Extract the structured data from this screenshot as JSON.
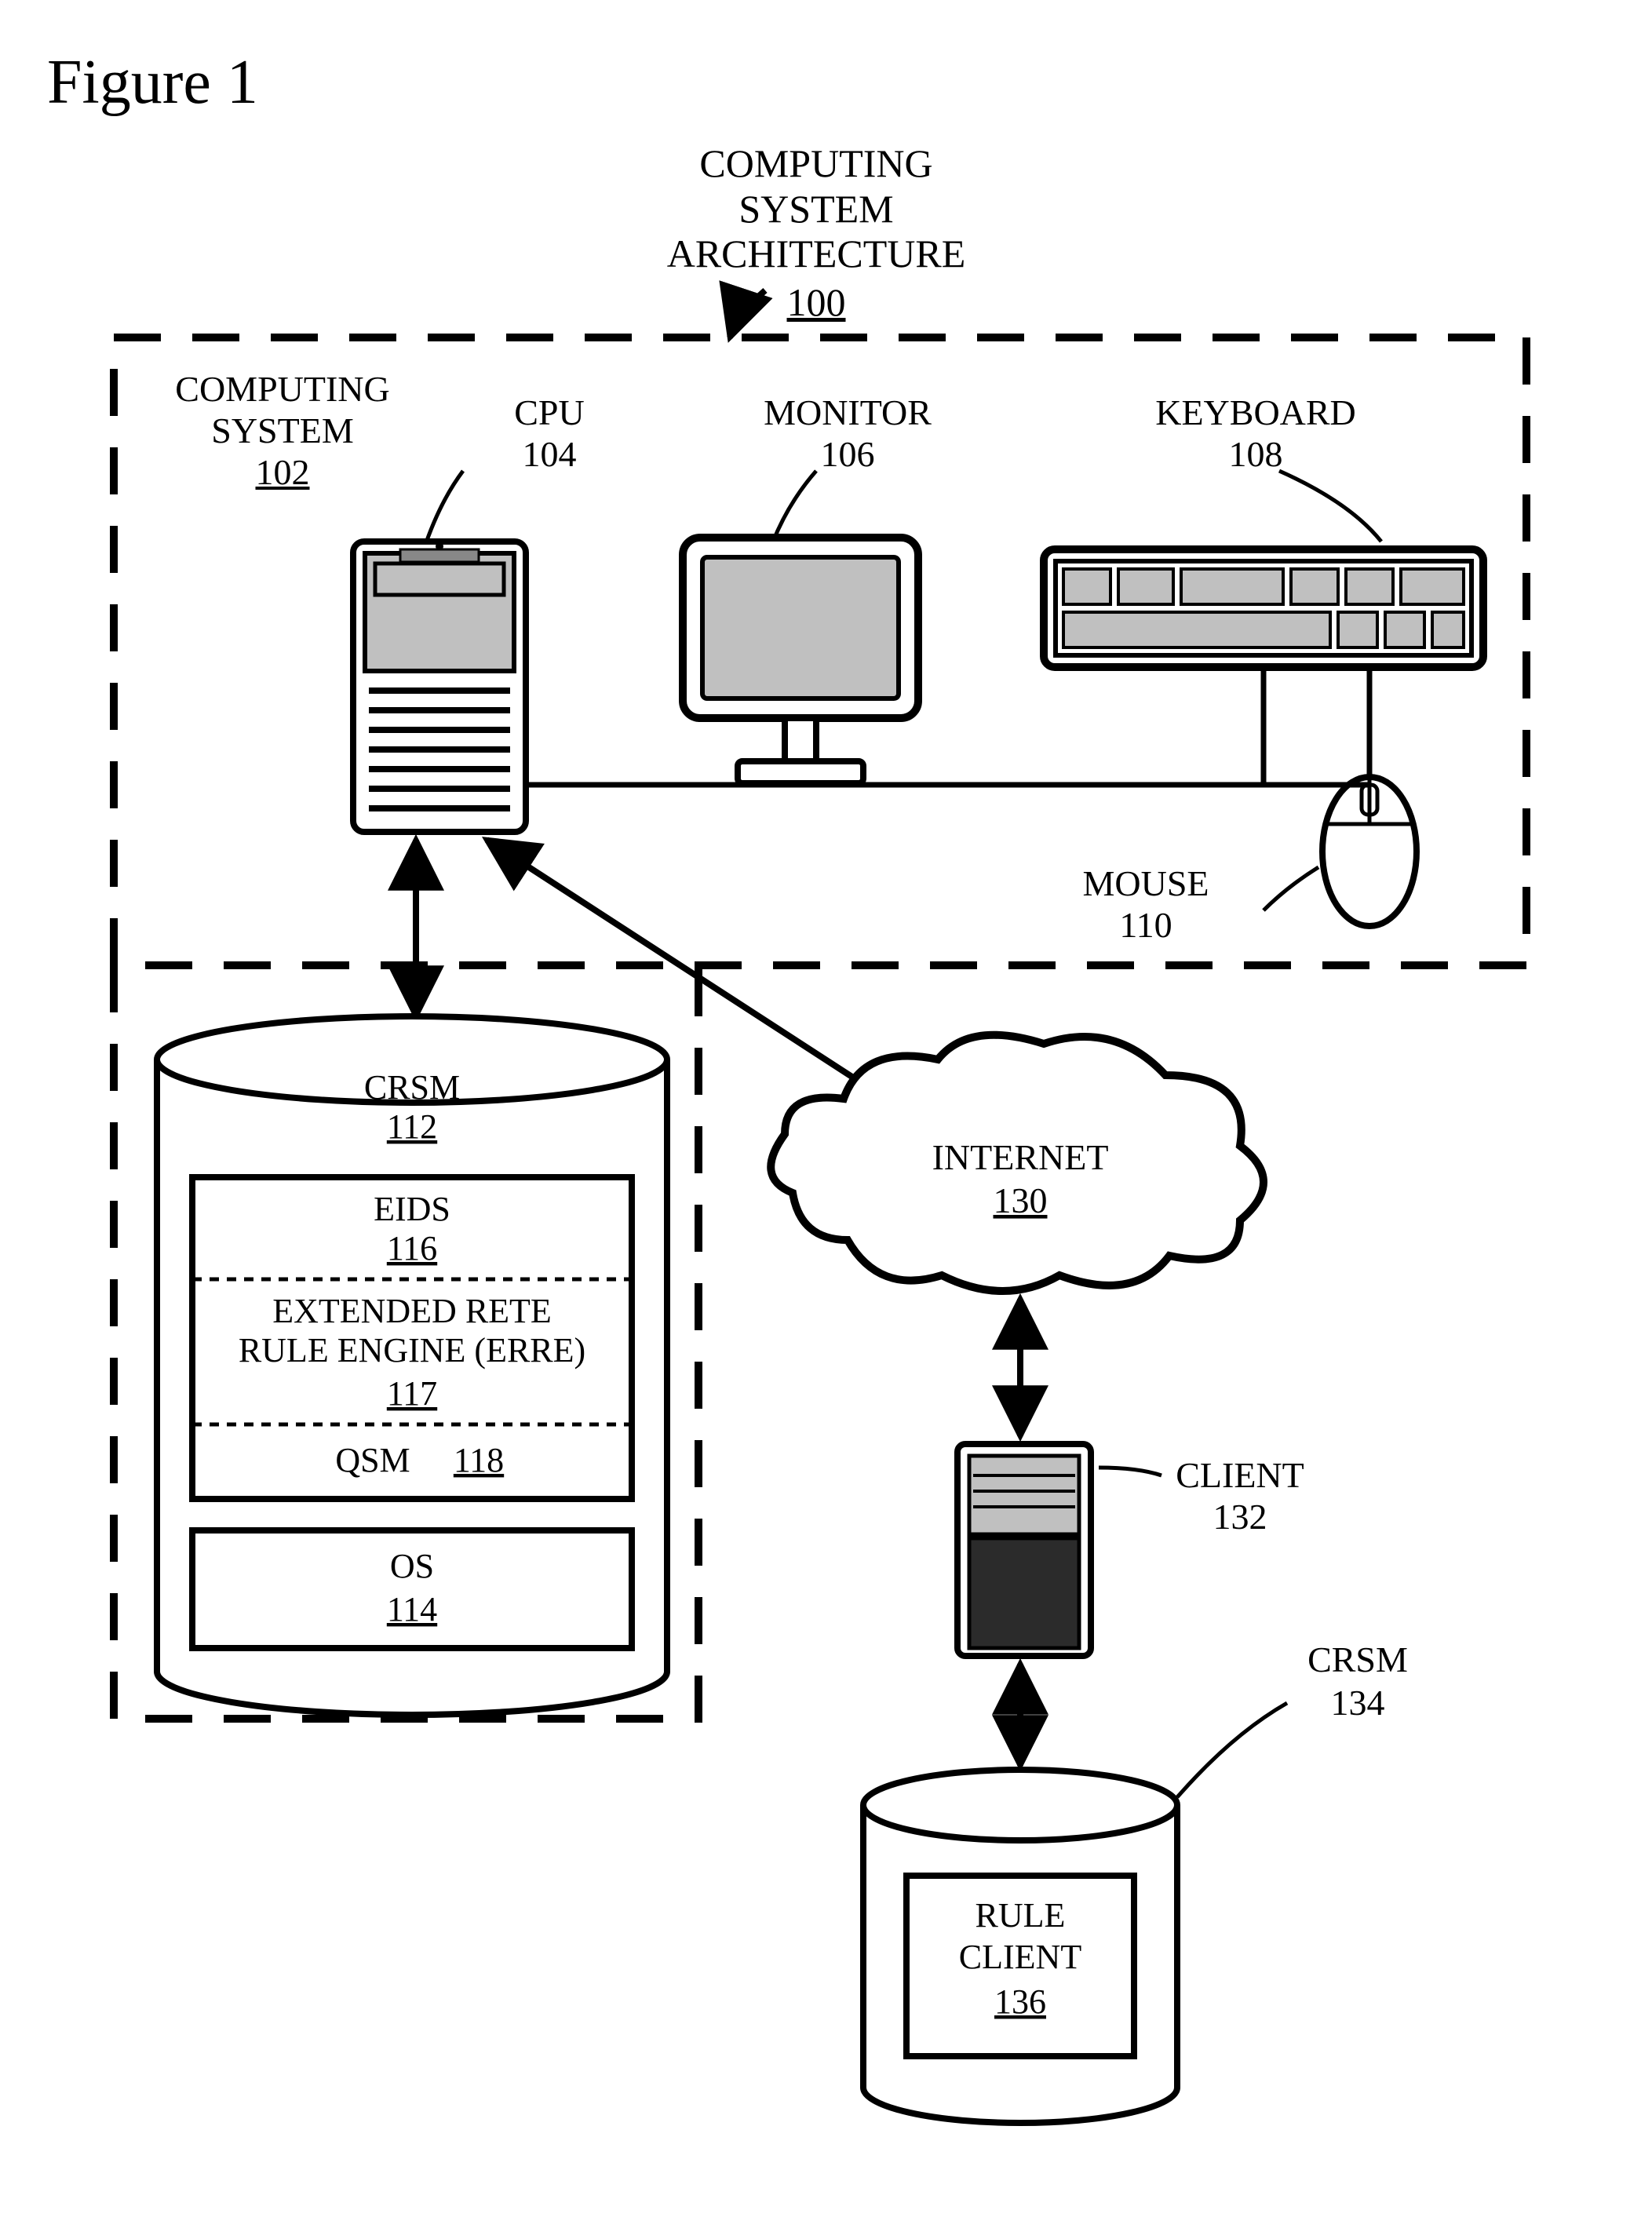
{
  "figure": {
    "title": "Figure 1"
  },
  "architecture": {
    "title_l1": "COMPUTING",
    "title_l2": "SYSTEM",
    "title_l3": "ARCHITECTURE",
    "ref": "100"
  },
  "computing_system": {
    "l1": "COMPUTING",
    "l2": "SYSTEM",
    "ref": "102"
  },
  "cpu": {
    "label": "CPU",
    "ref": "104"
  },
  "monitor": {
    "label": "MONITOR",
    "ref": "106"
  },
  "keyboard": {
    "label": "KEYBOARD",
    "ref": "108"
  },
  "mouse": {
    "label": "MOUSE",
    "ref": "110"
  },
  "crsm": {
    "label": "CRSM",
    "ref": "112"
  },
  "eids": {
    "label": "EIDS",
    "ref": "116"
  },
  "erre": {
    "l1": "EXTENDED RETE",
    "l2": "RULE ENGINE (ERRE)",
    "ref": "117"
  },
  "qsm": {
    "label": "QSM",
    "ref": "118"
  },
  "os": {
    "label": "OS",
    "ref": "114"
  },
  "internet": {
    "label": "INTERNET",
    "ref": "130"
  },
  "client": {
    "label": "CLIENT",
    "ref": "132"
  },
  "crsm2": {
    "label": "CRSM",
    "ref": "134"
  },
  "rule_client": {
    "l1": "RULE",
    "l2": "CLIENT",
    "ref": "136"
  }
}
